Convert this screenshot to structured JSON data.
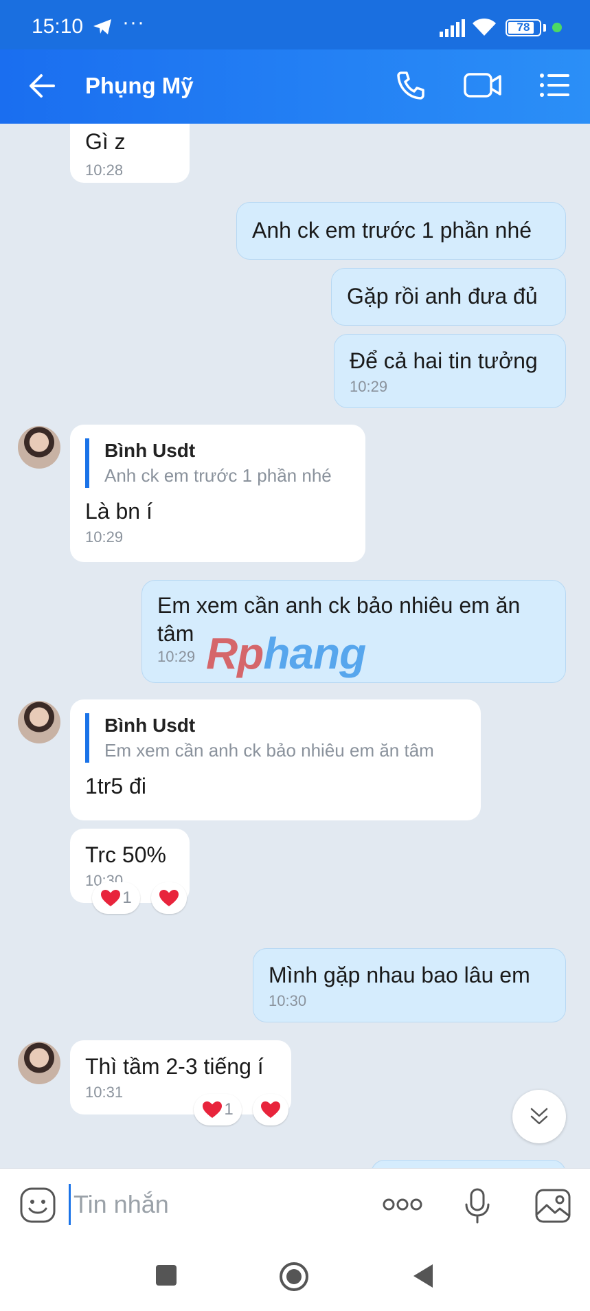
{
  "status": {
    "time": "15:10",
    "dots": "···",
    "battery": "78"
  },
  "header": {
    "contact_name": "Phụng Mỹ"
  },
  "messages": {
    "m1": {
      "text": "Gì z",
      "time": "10:28"
    },
    "m2": {
      "text": "Anh ck em trước 1 phần nhé"
    },
    "m3": {
      "text": "Gặp rồi anh đưa đủ"
    },
    "m4": {
      "text": "Để cả hai tin tưởng",
      "time": "10:29"
    },
    "m5": {
      "reply_name": "Bình Usdt",
      "reply_text": "Anh ck em trước 1 phần nhé",
      "text": "Là bn í",
      "time": "10:29"
    },
    "m6": {
      "text": "Em xem cần anh ck bảo nhiêu em ăn tâm",
      "time": "10:29"
    },
    "m7": {
      "reply_name": "Bình Usdt",
      "reply_text": "Em xem cần anh ck bảo nhiêu em ăn tâm",
      "text": "1tr5 đi"
    },
    "m8": {
      "text": "Trc 50%",
      "time": "10:30",
      "reaction_count": "1"
    },
    "m9": {
      "text": "Mình gặp nhau bao lâu em",
      "time": "10:30"
    },
    "m10": {
      "text": "Thì tầm 2-3 tiếng í",
      "time": "10:31",
      "reaction_count": "1"
    }
  },
  "watermark": {
    "part1": "Rp",
    "part2": "hang"
  },
  "input": {
    "placeholder": "Tin nhắn"
  },
  "icons": [
    "back-arrow-icon",
    "phone-icon",
    "video-call-icon",
    "menu-list-icon",
    "emoji-icon",
    "more-icon",
    "mic-icon",
    "image-icon",
    "chevron-down-icon",
    "heart-icon"
  ],
  "colors": {
    "header": "#1a6ef0",
    "outgoing_bubble": "#d5ecfd",
    "incoming_bubble": "#ffffff",
    "chat_bg": "#e2e9f1",
    "reply_bar": "#1a73e8",
    "heart": "#e8243c"
  }
}
